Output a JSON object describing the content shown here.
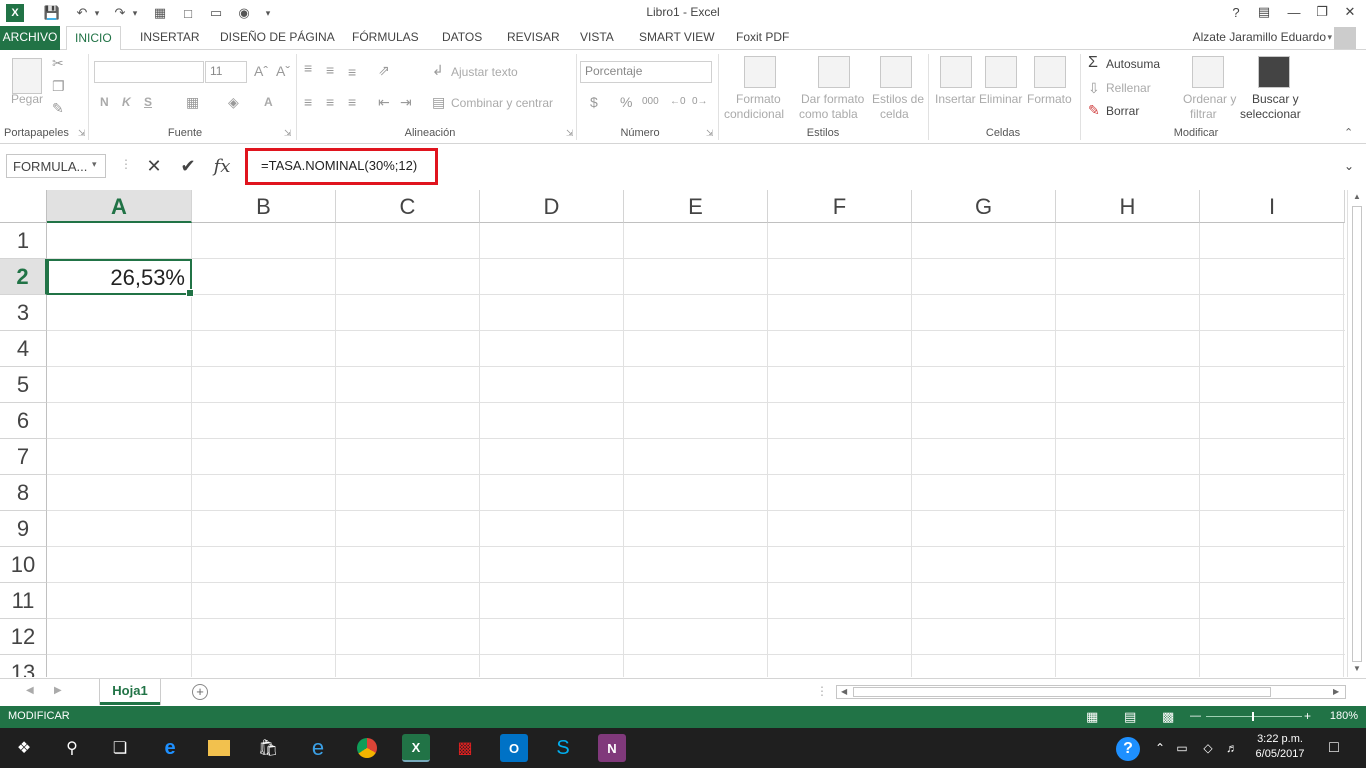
{
  "window": {
    "title": "Libro1 - Excel",
    "help": "?",
    "account": "Alzate Jaramillo Eduardo"
  },
  "tabs": [
    "ARCHIVO",
    "INICIO",
    "INSERTAR",
    "DISEÑO DE PÁGINA",
    "FÓRMULAS",
    "DATOS",
    "REVISAR",
    "VISTA",
    "SMART VIEW",
    "Foxit PDF"
  ],
  "ribbon": {
    "clipboard": {
      "paste": "Pegar",
      "label": "Portapapeles"
    },
    "font": {
      "size": "11",
      "bold": "N",
      "italic": "K",
      "underline": "S",
      "color": "A",
      "label": "Fuente"
    },
    "alignment": {
      "wrap": "Ajustar texto",
      "merge": "Combinar y centrar",
      "label": "Alineación"
    },
    "number": {
      "format": "Porcentaje",
      "label": "Número"
    },
    "styles": {
      "conditional_1": "Formato",
      "conditional_2": "condicional",
      "table_1": "Dar formato",
      "table_2": "como tabla",
      "cell_1": "Estilos de",
      "cell_2": "celda",
      "label": "Estilos"
    },
    "cells": {
      "insert": "Insertar",
      "delete": "Eliminar",
      "format": "Formato",
      "label": "Celdas"
    },
    "editing": {
      "autosum": "Autosuma",
      "fill": "Rellenar",
      "clear": "Borrar",
      "sort_1": "Ordenar y",
      "sort_2": "filtrar",
      "find_1": "Buscar y",
      "find_2": "seleccionar",
      "label": "Modificar"
    }
  },
  "formula_bar": {
    "name_box": "FORMULA...",
    "formula": "=TASA.NOMINAL(30%;12)"
  },
  "sheet": {
    "columns": [
      "A",
      "B",
      "C",
      "D",
      "E",
      "F",
      "G",
      "H",
      "I"
    ],
    "rows": [
      "1",
      "2",
      "3",
      "4",
      "5",
      "6",
      "7",
      "8",
      "9",
      "10",
      "11",
      "12",
      "13"
    ],
    "active_cell_value": "26,53%",
    "tab_name": "Hoja1"
  },
  "status": {
    "mode": "MODIFICAR",
    "zoom": "180%"
  },
  "taskbar": {
    "time": "3:22 p.m.",
    "date": "6/05/2017"
  },
  "colors": {
    "excel_green": "#217346",
    "highlight_red": "#e0141e"
  }
}
